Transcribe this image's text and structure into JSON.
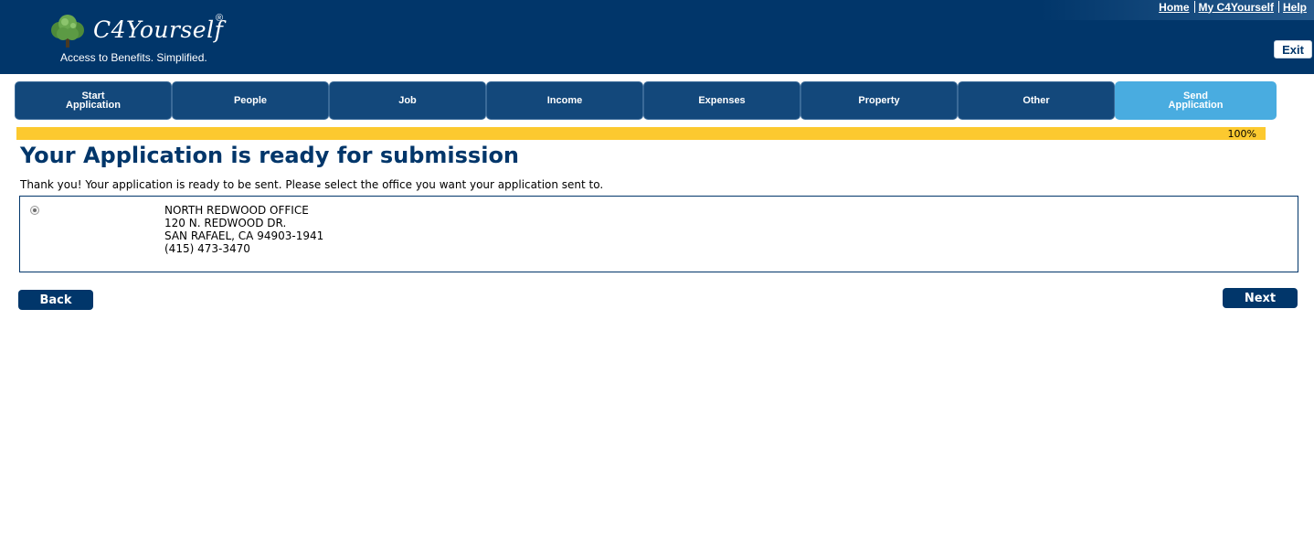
{
  "header": {
    "app_name": "C4Yourself",
    "registered_mark": "®",
    "tagline": "Access to Benefits.  Simplified.",
    "logo_icon": "tree-icon",
    "links": [
      {
        "label": "Home"
      },
      {
        "label": "My C4Yourself"
      },
      {
        "label": "Help"
      }
    ],
    "exit_label": "Exit"
  },
  "tabs": [
    {
      "line1": "Start",
      "line2": "Application",
      "active": false
    },
    {
      "line1": "People",
      "line2": "",
      "active": false
    },
    {
      "line1": "Job",
      "line2": "",
      "active": false
    },
    {
      "line1": "Income",
      "line2": "",
      "active": false
    },
    {
      "line1": "Expenses",
      "line2": "",
      "active": false
    },
    {
      "line1": "Property",
      "line2": "",
      "active": false
    },
    {
      "line1": "Other",
      "line2": "",
      "active": false
    },
    {
      "line1": "Send",
      "line2": "Application",
      "active": true
    }
  ],
  "progress": {
    "percent": 100,
    "label": "100%"
  },
  "main": {
    "title": "Your Application is ready for submission",
    "instructions": "Thank you! Your application is ready to be sent. Please select the office you want your application sent to.",
    "office": {
      "selected": true,
      "name": "NORTH REDWOOD OFFICE",
      "street": "120 N. REDWOOD DR.",
      "city_state_zip": "SAN RAFAEL, CA 94903-1941",
      "phone": "(415) 473-3470"
    },
    "back_label": "Back",
    "next_label": "Next"
  },
  "colors": {
    "brand_navy": "#01366a",
    "tab_blue": "#13487b",
    "tab_active": "#49ace0",
    "progress_yellow": "#fcc92f"
  }
}
